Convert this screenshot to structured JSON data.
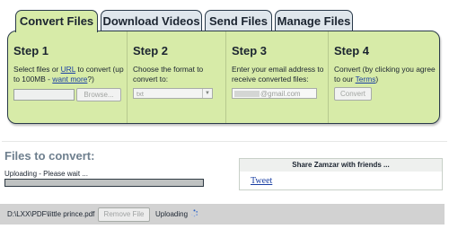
{
  "tabs": [
    {
      "label": "Convert Files",
      "active": true
    },
    {
      "label": "Download Videos",
      "active": false
    },
    {
      "label": "Send Files",
      "active": false
    },
    {
      "label": "Manage Files",
      "active": false
    }
  ],
  "steps": {
    "step1": {
      "title": "Step 1",
      "text_before_link": "Select files or ",
      "url_link": "URL",
      "text_after_link": " to convert (up to 100MB - ",
      "want_more_link": "want more",
      "text_end": "?)",
      "file_value": "",
      "browse_label": "Browse..."
    },
    "step2": {
      "title": "Step 2",
      "desc": "Choose the format to convert to:",
      "selected_format": "txt"
    },
    "step3": {
      "title": "Step 3",
      "desc": "Enter your email address to receive converted files:",
      "email_value": "@gmail.com"
    },
    "step4": {
      "title": "Step 4",
      "text_before_link": "Convert (by clicking you agree to our ",
      "terms_link": "Terms",
      "text_end": ")",
      "convert_label": "Convert"
    }
  },
  "files_section": {
    "heading": "Files to convert:",
    "upload_status": "Uploading - Please wait ...",
    "progress_fraction": 1.0
  },
  "share": {
    "title": "Share Zamzar with friends ...",
    "tweet_label": "Tweet"
  },
  "file_row": {
    "path": "D:\\LXX\\PDF\\little prince.pdf",
    "remove_label": "Remove File",
    "status": "Uploading"
  },
  "colors": {
    "panel_green": "#d7eba8",
    "tab_inactive": "#dfe6ec",
    "link_blue": "#1a3fa3",
    "heading_gray": "#6e7f8e"
  },
  "icons": [
    "select-arrow-icon",
    "spinner-icon"
  ]
}
